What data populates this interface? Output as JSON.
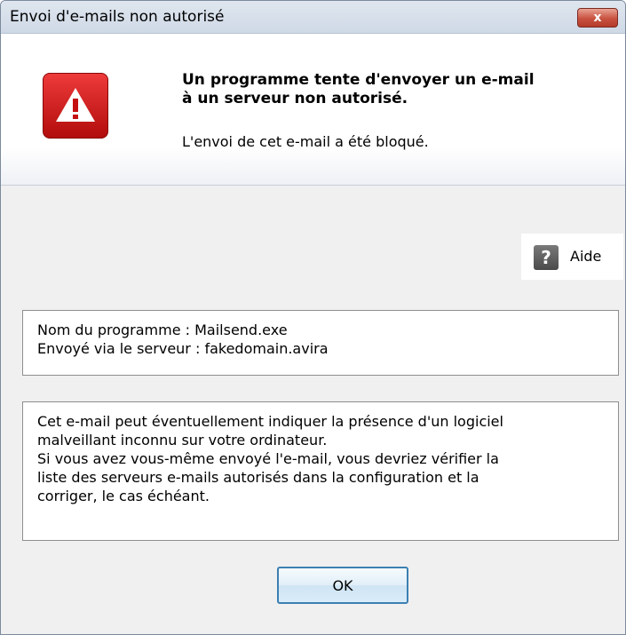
{
  "window": {
    "title": "Envoi d'e-mails non autorisé",
    "close_label": "x"
  },
  "header": {
    "icon": "warning-triangle-icon",
    "heading_line1": "Un programme tente d'envoyer un e-mail",
    "heading_line2": "à un serveur non autorisé.",
    "subtext": "L'envoi de cet e-mail a été bloqué."
  },
  "help": {
    "icon": "help-question-icon",
    "label": "Aide"
  },
  "info": {
    "program_line": "Nom du programme : Mailsend.exe",
    "server_line": "Envoyé via le serveur : fakedomain.avira"
  },
  "description": {
    "lines": [
      "Cet e-mail peut éventuellement indiquer la présence d'un logiciel",
      "malveillant inconnu sur votre ordinateur.",
      "Si vous avez vous-même envoyé l'e-mail, vous devriez vérifier la",
      "liste des serveurs e-mails autorisés dans la configuration et la",
      "corriger, le cas échéant."
    ]
  },
  "buttons": {
    "ok_label": "OK"
  },
  "colors": {
    "warning_red": "#d21c1c",
    "close_red": "#c8513f",
    "button_border": "#3c7fb1"
  }
}
